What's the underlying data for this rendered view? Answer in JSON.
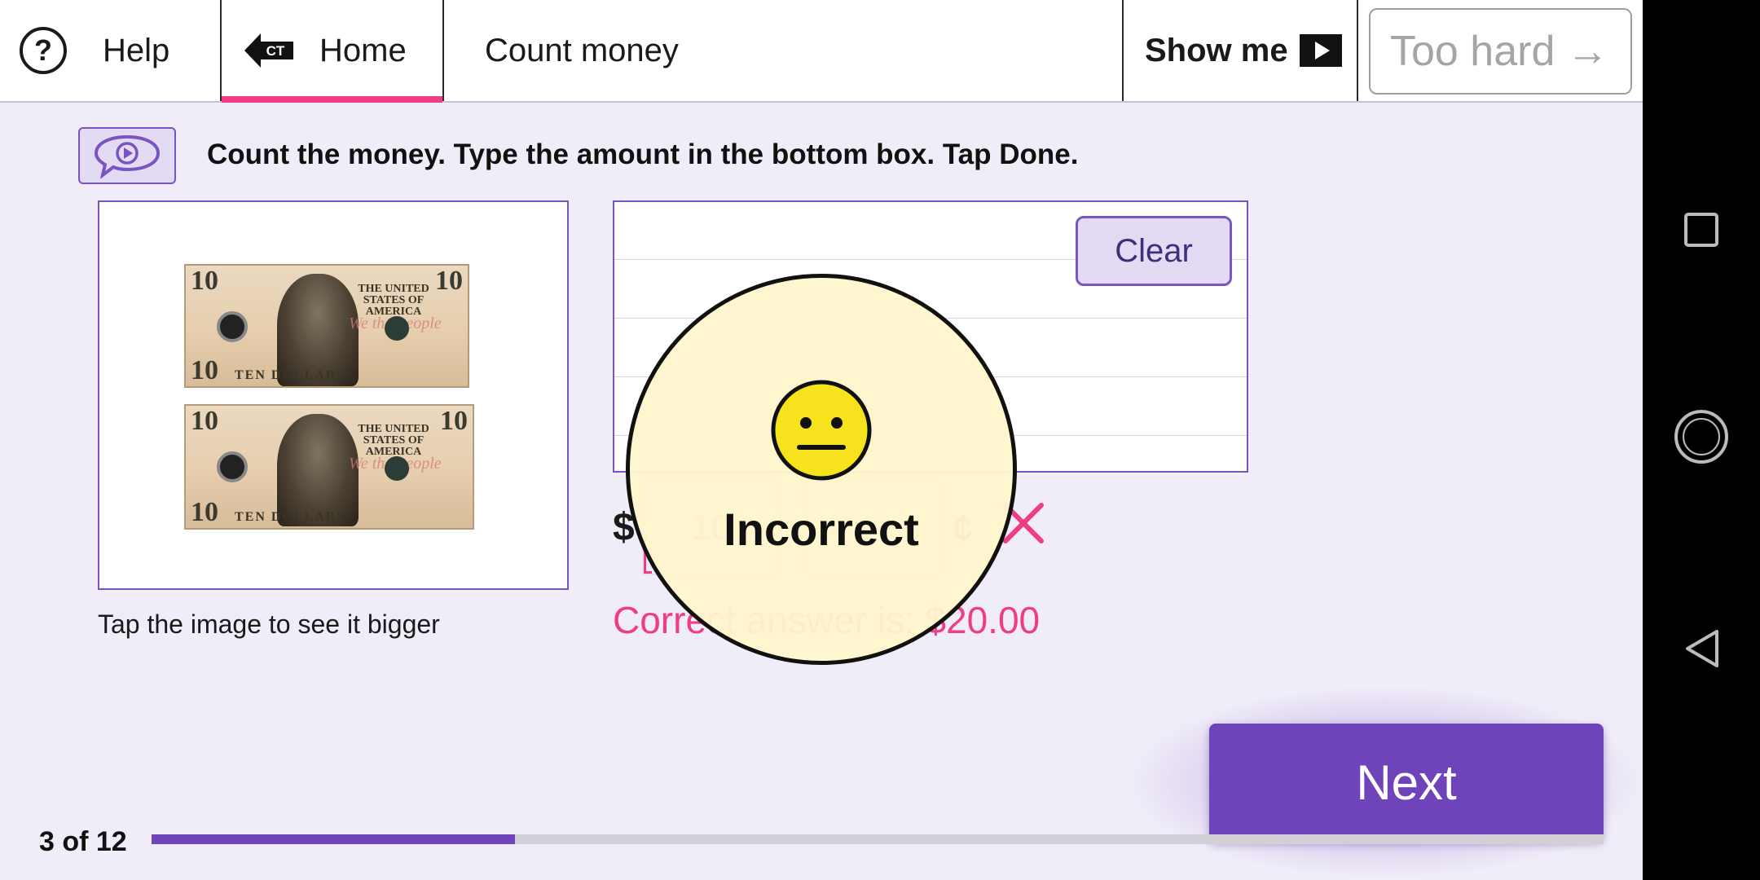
{
  "topbar": {
    "help_label": "Help",
    "home_label": "Home",
    "home_icon_text": "CT",
    "title": "Count money",
    "show_me_label": "Show me",
    "too_hard_label": "Too hard",
    "too_hard_arrow": "→",
    "help_icon_text": "?"
  },
  "instruction": "Count the money. Type the amount in the bottom box. Tap Done.",
  "image_caption": "Tap the image to see it bigger",
  "bills": [
    {
      "value": "10",
      "top_text": "THE UNITED STATES OF AMERICA",
      "bottom_text": "TEN    DOLLARS",
      "script": "We the People"
    },
    {
      "value": "10",
      "top_text": "THE UNITED STATES OF AMERICA",
      "bottom_text": "TEN    DOLLARS",
      "script": "We the People"
    }
  ],
  "answer": {
    "clear_label": "Clear",
    "dollar_sign": "$",
    "dollars_value": "10",
    "cents_value": "",
    "cent_sign": "¢",
    "correct_answer_text": "Correct answer is: $20.00"
  },
  "feedback": {
    "text": "Incorrect",
    "face": "neutral-face"
  },
  "next_label": "Next",
  "progress": {
    "label": "3 of 12",
    "current": 3,
    "total": 12,
    "fraction": 0.25
  },
  "colors": {
    "accent": "#6f43b9",
    "error": "#ee3d84",
    "background": "#f0edf8",
    "feedback_bg": "#fff5cd"
  },
  "android_nav": [
    "square-icon",
    "circle-icon",
    "back-triangle-icon"
  ]
}
